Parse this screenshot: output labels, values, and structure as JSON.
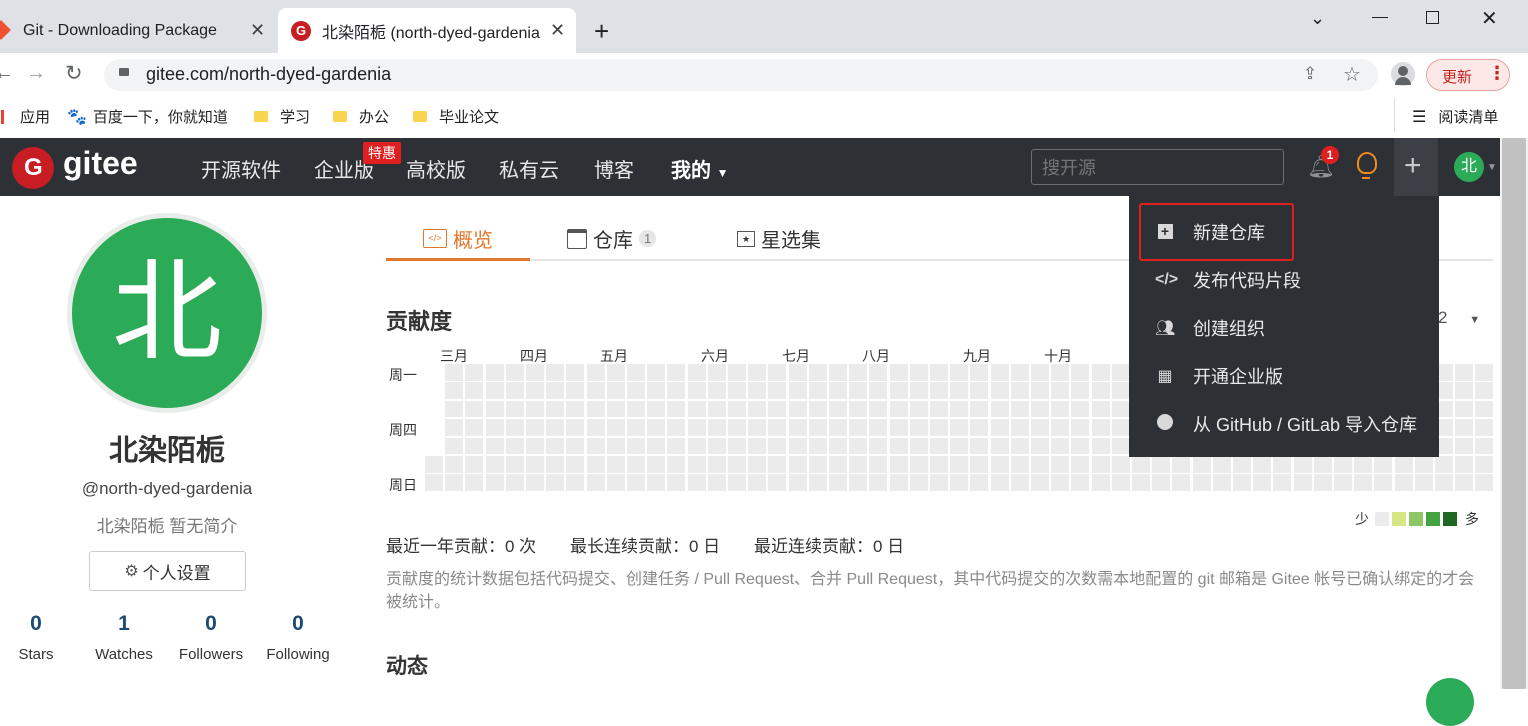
{
  "browser": {
    "tabs": [
      {
        "title": "Git - Downloading Package"
      },
      {
        "title": "北染陌栀 (north-dyed-gardenia"
      }
    ],
    "new_tab": "+",
    "url": "gitee.com/north-dyed-gardenia",
    "update_button": "更新",
    "bookmarks": [
      "应用",
      "百度一下，你就知道",
      "学习",
      "办公",
      "毕业论文"
    ],
    "reading_list": "阅读清单"
  },
  "gitee_nav": {
    "logo_text": "gitee",
    "items": [
      "开源软件",
      "企业版",
      "高校版",
      "私有云",
      "博客",
      "我的"
    ],
    "special_badge": "特惠",
    "search_placeholder": "搜开源",
    "notification_count": "1",
    "avatar_char": "北"
  },
  "profile": {
    "avatar_char": "北",
    "name": "北染陌栀",
    "handle": "@north-dyed-gardenia",
    "bio": "北染陌栀 暂无简介",
    "settings_button": "个人设置",
    "stats": [
      {
        "value": "0",
        "label": "Stars"
      },
      {
        "value": "1",
        "label": "Watches"
      },
      {
        "value": "0",
        "label": "Followers"
      },
      {
        "value": "0",
        "label": "Following"
      }
    ]
  },
  "tabs": {
    "overview": "概览",
    "repos": "仓库",
    "repo_count": "1",
    "stars": "星选集"
  },
  "contrib": {
    "title": "贡献度",
    "year_fragment": "2",
    "months": [
      "三月",
      "四月",
      "五月",
      "六月",
      "七月",
      "八月",
      "九月",
      "十月"
    ],
    "weekdays": [
      "周一",
      "周四",
      "周日"
    ],
    "legend_less": "少",
    "legend_more": "多",
    "legend_colors": [
      "#ebebeb",
      "#d6e685",
      "#8cc665",
      "#44a340",
      "#1e6823"
    ],
    "summary": {
      "last_year": "最近一年贡献：0 次",
      "longest": "最长连续贡献：0 日",
      "recent": "最近连续贡献：0 日"
    },
    "note": "贡献度的统计数据包括代码提交、创建任务 / Pull Request、合并 Pull Request，其中代码提交的次数需本地配置的 git 邮箱是 Gitee 帐号已确认绑定的才会被统计。"
  },
  "activity_title": "动态",
  "dropdown": {
    "items": [
      "新建仓库",
      "发布代码片段",
      "创建组织",
      "开通企业版",
      "从 GitHub / GitLab 导入仓库"
    ]
  }
}
